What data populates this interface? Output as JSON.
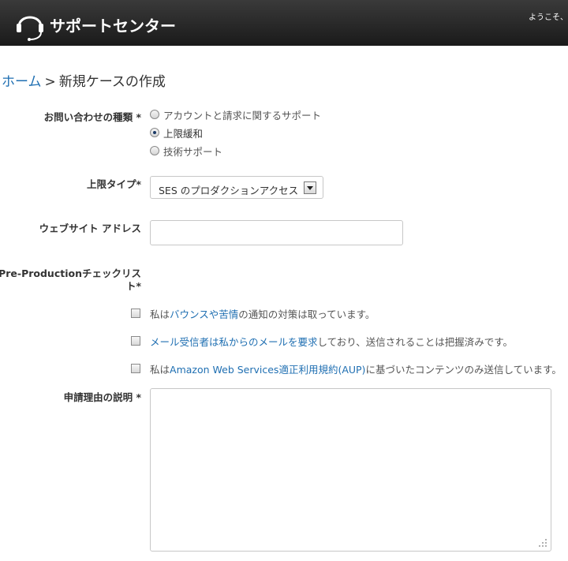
{
  "header": {
    "site_title": "サポートセンター",
    "welcome": "ようこそ、"
  },
  "breadcrumb": {
    "home": "ホーム",
    "separator": ">",
    "current": "新規ケースの作成"
  },
  "form": {
    "inquiry_type": {
      "label": "お問い合わせの種類 *",
      "options": [
        {
          "label": "アカウントと請求に関するサポート",
          "checked": false
        },
        {
          "label": "上限緩和",
          "checked": true
        },
        {
          "label": "技術サポート",
          "checked": false
        }
      ]
    },
    "limit_type": {
      "label": "上限タイプ*",
      "selected": "SES のプロダクションアクセス"
    },
    "website": {
      "label": "ウェブサイト アドレス",
      "value": ""
    },
    "checklist": {
      "label_line1": "Pre-Productionチェックリス",
      "label_line2": "ト*",
      "items": [
        {
          "parts": [
            "私は",
            "バウンスや苦情",
            "の通知の対策は取っています。"
          ]
        },
        {
          "parts": [
            "",
            "メール受信者は私からのメールを要求",
            "しており、送信されることは把握済みです。"
          ]
        },
        {
          "parts": [
            "私は",
            "Amazon Web Services適正利用規約(AUP)",
            "に基づいたコンテンツのみ送信しています。"
          ]
        }
      ]
    },
    "reason": {
      "label": "申請理由の説明 *",
      "value": ""
    }
  },
  "colors": {
    "header_bg": "#222222",
    "link": "#1f6fb2"
  }
}
